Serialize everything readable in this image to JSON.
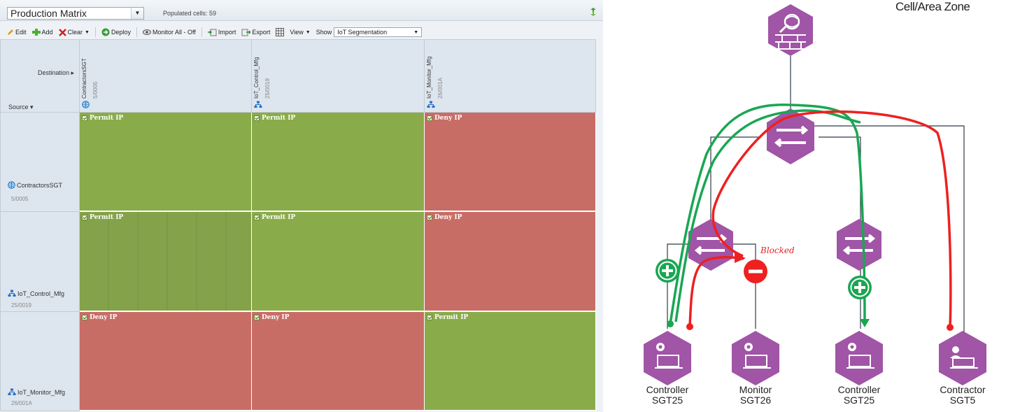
{
  "window": {
    "matrix_name": "Production Matrix",
    "populated": "Populated cells: 59",
    "refresh_icon": "refresh-icon"
  },
  "toolbar": {
    "edit": "Edit",
    "add": "Add",
    "clear": "Clear",
    "deploy": "Deploy",
    "monitor": "Monitor All - Off",
    "import": "Import",
    "export": "Export",
    "view": "View",
    "show_label": "Show",
    "show_value": "IoT Segmentation"
  },
  "matrix": {
    "destination_label": "Destination ▸",
    "source_label": "Source ▾",
    "columns": [
      {
        "name": "ContractorsSGT",
        "num": "5/0005",
        "icon": "globe-icon"
      },
      {
        "name": "IoT_Control_Mfg",
        "num": "25/0019",
        "icon": "network-icon"
      },
      {
        "name": "IoT_Monitor_Mfg",
        "num": "26/001A",
        "icon": "network-icon"
      }
    ],
    "rows": [
      {
        "name": "ContractorsSGT",
        "num": "5/0005",
        "icon": "globe-icon"
      },
      {
        "name": "IoT_Control_Mfg",
        "num": "25/0019",
        "icon": "network-icon"
      },
      {
        "name": "IoT_Monitor_Mfg",
        "num": "26/001A",
        "icon": "network-icon"
      }
    ],
    "cells": [
      [
        "Permit IP",
        "Permit IP",
        "Deny IP"
      ],
      [
        "Permit IP",
        "Permit IP",
        "Deny IP"
      ],
      [
        "Deny IP",
        "Deny IP",
        "Permit IP"
      ]
    ],
    "colors": {
      "permit": "#8aab4a",
      "deny": "#c86d66"
    }
  },
  "topology": {
    "title": "Cell/Area Zone",
    "blocked": "Blocked",
    "accent": "#a055a6",
    "flow_permit_color": "#1aa653",
    "flow_deny_color": "#ee2020",
    "nodes": [
      {
        "l1": "Controller",
        "l2": "SGT25",
        "icon": "controller-icon"
      },
      {
        "l1": "Monitor",
        "l2": "SGT26",
        "icon": "monitor-icon"
      },
      {
        "l1": "Controller",
        "l2": "SGT25",
        "icon": "controller-icon"
      },
      {
        "l1": "Contractor",
        "l2": "SGT5",
        "icon": "contractor-icon"
      }
    ]
  }
}
